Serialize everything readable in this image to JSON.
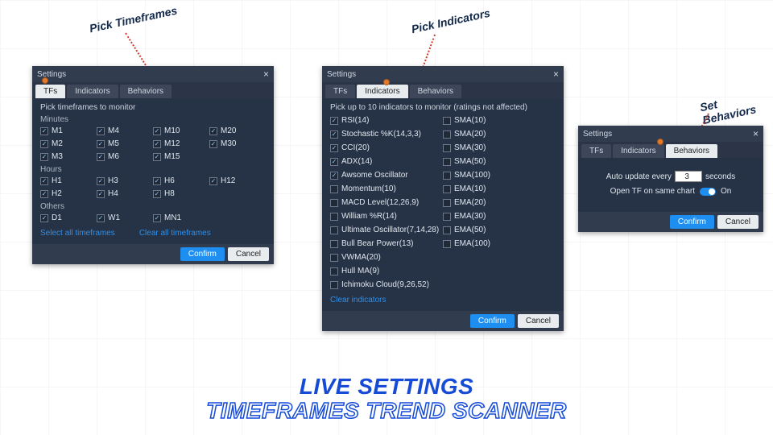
{
  "callouts": {
    "pick_tf": "Pick Timeframes",
    "pick_ind": "Pick Indicators",
    "set_beh": "Set Behaviors"
  },
  "titles": {
    "line1": "LIVE SETTINGS",
    "line2": "TIMEFRAMES TREND SCANNER"
  },
  "dlgTF": {
    "title": "Settings",
    "tabs": [
      "TFs",
      "Indicators",
      "Behaviors"
    ],
    "active_tab": 0,
    "instruction": "Pick timeframes to monitor",
    "groups": {
      "minutes": {
        "header": "Minutes",
        "cols": [
          [
            {
              "label": "M1",
              "on": true
            },
            {
              "label": "M2",
              "on": true
            },
            {
              "label": "M3",
              "on": true
            }
          ],
          [
            {
              "label": "M4",
              "on": true
            },
            {
              "label": "M5",
              "on": true
            },
            {
              "label": "M6",
              "on": true
            }
          ],
          [
            {
              "label": "M10",
              "on": true
            },
            {
              "label": "M12",
              "on": true
            },
            {
              "label": "M15",
              "on": true
            }
          ],
          [
            {
              "label": "M20",
              "on": true
            },
            {
              "label": "M30",
              "on": true
            }
          ]
        ]
      },
      "hours": {
        "header": "Hours",
        "cols": [
          [
            {
              "label": "H1",
              "on": true
            },
            {
              "label": "H2",
              "on": true
            }
          ],
          [
            {
              "label": "H3",
              "on": true
            },
            {
              "label": "H4",
              "on": true
            }
          ],
          [
            {
              "label": "H6",
              "on": true
            },
            {
              "label": "H8",
              "on": true
            }
          ],
          [
            {
              "label": "H12",
              "on": true
            }
          ]
        ]
      },
      "others": {
        "header": "Others",
        "cols": [
          [
            {
              "label": "D1",
              "on": true
            }
          ],
          [
            {
              "label": "W1",
              "on": true
            }
          ],
          [
            {
              "label": "MN1",
              "on": true
            }
          ],
          []
        ]
      }
    },
    "links": {
      "select_all": "Select all timeframes",
      "clear_all": "Clear all timeframes"
    },
    "buttons": {
      "confirm": "Confirm",
      "cancel": "Cancel"
    }
  },
  "dlgInd": {
    "title": "Settings",
    "tabs": [
      "TFs",
      "Indicators",
      "Behaviors"
    ],
    "active_tab": 1,
    "instruction": "Pick up to 10 indicators to monitor (ratings not affected)",
    "left": [
      {
        "label": "RSI(14)",
        "on": true
      },
      {
        "label": "Stochastic %K(14,3,3)",
        "on": true
      },
      {
        "label": "CCI(20)",
        "on": true
      },
      {
        "label": "ADX(14)",
        "on": true
      },
      {
        "label": "Awsome Oscillator",
        "on": true
      },
      {
        "label": "Momentum(10)",
        "on": false
      },
      {
        "label": "MACD Level(12,26,9)",
        "on": false
      },
      {
        "label": "William %R(14)",
        "on": false
      },
      {
        "label": "Ultimate Oscillator(7,14,28)",
        "on": false
      },
      {
        "label": "Bull Bear Power(13)",
        "on": false
      },
      {
        "label": "VWMA(20)",
        "on": false
      },
      {
        "label": "Hull MA(9)",
        "on": false
      },
      {
        "label": "Ichimoku Cloud(9,26,52)",
        "on": false
      }
    ],
    "right": [
      {
        "label": "SMA(10)",
        "on": false
      },
      {
        "label": "SMA(20)",
        "on": false
      },
      {
        "label": "SMA(30)",
        "on": false
      },
      {
        "label": "SMA(50)",
        "on": false
      },
      {
        "label": "SMA(100)",
        "on": false
      },
      {
        "label": "EMA(10)",
        "on": false
      },
      {
        "label": "EMA(20)",
        "on": false
      },
      {
        "label": "EMA(30)",
        "on": false
      },
      {
        "label": "EMA(50)",
        "on": false
      },
      {
        "label": "EMA(100)",
        "on": false
      }
    ],
    "clear_link": "Clear indicators",
    "buttons": {
      "confirm": "Confirm",
      "cancel": "Cancel"
    }
  },
  "dlgBeh": {
    "title": "Settings",
    "tabs": [
      "TFs",
      "Indicators",
      "Behaviors"
    ],
    "active_tab": 2,
    "auto_update": {
      "prefix": "Auto update every",
      "value": "3",
      "suffix": "seconds"
    },
    "open_tf": {
      "label": "Open TF on same chart",
      "state": "On"
    },
    "buttons": {
      "confirm": "Confirm",
      "cancel": "Cancel"
    }
  }
}
